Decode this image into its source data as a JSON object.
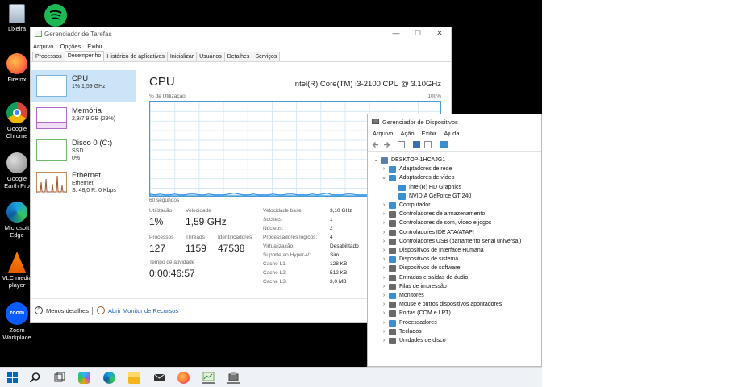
{
  "desktop": {
    "icons": [
      {
        "label": "Lixeira",
        "icon": "recycle-bin-icon"
      },
      {
        "label": "Firefox",
        "icon": "firefox-icon"
      },
      {
        "label": "Google Chrome",
        "icon": "chrome-icon"
      },
      {
        "label": "Google Earth Pro",
        "icon": "google-earth-icon"
      },
      {
        "label": "Microsoft Edge",
        "icon": "edge-icon"
      },
      {
        "label": "VLC media player",
        "icon": "vlc-icon"
      },
      {
        "label": "Zoom Workplace",
        "icon": "zoom-icon"
      }
    ],
    "zoom_logo_text": "zoom"
  },
  "taskmgr": {
    "title": "Gerenciador de Tarefas",
    "menu": [
      "Arquivo",
      "Opções",
      "Exibir"
    ],
    "tabs": [
      "Processos",
      "Desempenho",
      "Histórico de aplicativos",
      "Inicializar",
      "Usuários",
      "Detalhes",
      "Serviços"
    ],
    "active_tab": "Desempenho",
    "sidebar": [
      {
        "name": "CPU",
        "line1": "1% 1,59 GHz",
        "line2": "",
        "color": "#1e88e5"
      },
      {
        "name": "Memória",
        "line1": "2,3/7,9 GB (29%)",
        "line2": "",
        "color": "#9c27b0"
      },
      {
        "name": "Disco 0 (C:)",
        "line1": "SSD",
        "line2": "0%",
        "color": "#4caf50"
      },
      {
        "name": "Ethernet",
        "line1": "Ethernet",
        "line2": "S: 48,0 R: 0 Kbps",
        "color": "#a0522d"
      }
    ],
    "cpu": {
      "title": "CPU",
      "model": "Intel(R) Core(TM) i3-2100 CPU @ 3.10GHz",
      "graph_label": "% de Utilização",
      "graph_max": "100%",
      "graph_time": "60 segundos",
      "utilization_series": [
        2,
        1,
        2,
        1,
        1,
        2,
        1,
        1,
        2,
        2,
        1,
        1,
        2,
        1,
        1,
        1,
        2,
        3,
        2,
        1,
        1,
        2,
        1,
        1,
        1,
        2,
        1,
        1,
        2,
        2,
        1,
        1,
        1,
        2,
        1,
        2,
        3,
        1,
        1,
        1,
        2,
        2,
        1,
        1,
        1,
        2,
        1,
        1,
        2,
        1,
        1,
        2,
        2,
        4,
        3,
        2,
        1,
        2,
        1,
        1
      ],
      "stats": {
        "utilizacao_label": "Utilização",
        "utilizacao": "1%",
        "velocidade_label": "Velocidade",
        "velocidade": "1,59 GHz",
        "processos_label": "Processos",
        "processos": "127",
        "threads_label": "Threads",
        "threads": "1159",
        "identificadores_label": "Identificadores",
        "identificadores": "47538",
        "tempo_label": "Tempo de atividade",
        "tempo": "0:00:46:57"
      },
      "details": [
        {
          "k": "Velocidade base:",
          "v": "3,10 GHz"
        },
        {
          "k": "Sockets:",
          "v": "1"
        },
        {
          "k": "Núcleos:",
          "v": "2"
        },
        {
          "k": "Processadores lógicos:",
          "v": "4"
        },
        {
          "k": "Virtualização:",
          "v": "Desabilitado"
        },
        {
          "k": "Suporte ao Hyper-V:",
          "v": "Sim"
        },
        {
          "k": "Cache L1:",
          "v": "128 KB"
        },
        {
          "k": "Cache L2:",
          "v": "512 KB"
        },
        {
          "k": "Cache L3:",
          "v": "3,0 MB"
        }
      ]
    },
    "footer": {
      "fewer_details": "Menos detalhes",
      "resource_monitor": "Abrir Monitor de Recursos"
    }
  },
  "devmgr": {
    "title": "Gerenciador de Dispositivos",
    "menu": [
      "Arquivo",
      "Ação",
      "Exibir",
      "Ajuda"
    ],
    "tree": [
      {
        "label": "DESKTOP-1HCAJG1",
        "level": 0,
        "expanded": true,
        "color": "#5b7fa6"
      },
      {
        "label": "Adaptadores de rede",
        "level": 1,
        "expanded": false,
        "color": "#3a8fd1"
      },
      {
        "label": "Adaptadores de vídeo",
        "level": 1,
        "expanded": true,
        "color": "#3a8fd1"
      },
      {
        "label": "Intel(R) HD Graphics",
        "level": 2,
        "color": "#3a8fd1"
      },
      {
        "label": "NVIDIA GeForce GT 240",
        "level": 2,
        "color": "#3a8fd1"
      },
      {
        "label": "Computador",
        "level": 1,
        "expanded": false,
        "color": "#3a8fd1"
      },
      {
        "label": "Controladores de armazenamento",
        "level": 1,
        "expanded": false,
        "color": "#6a6a6a"
      },
      {
        "label": "Controladores de som, vídeo e jogos",
        "level": 1,
        "expanded": false,
        "color": "#6a6a6a"
      },
      {
        "label": "Controladores IDE ATA/ATAPI",
        "level": 1,
        "expanded": false,
        "color": "#6a6a6a"
      },
      {
        "label": "Controladores USB (barramento serial universal)",
        "level": 1,
        "expanded": false,
        "color": "#6a6a6a"
      },
      {
        "label": "Dispositivos de Interface Humana",
        "level": 1,
        "expanded": false,
        "color": "#6a6a6a"
      },
      {
        "label": "Dispositivos de sistema",
        "level": 1,
        "expanded": false,
        "color": "#3a8fd1"
      },
      {
        "label": "Dispositivos de software",
        "level": 1,
        "expanded": false,
        "color": "#6a6a6a"
      },
      {
        "label": "Entradas e saídas de áudio",
        "level": 1,
        "expanded": false,
        "color": "#6a6a6a"
      },
      {
        "label": "Filas de impressão",
        "level": 1,
        "expanded": false,
        "color": "#6a6a6a"
      },
      {
        "label": "Monitores",
        "level": 1,
        "expanded": false,
        "color": "#3a8fd1"
      },
      {
        "label": "Mouse e outros dispositivos apontadores",
        "level": 1,
        "expanded": false,
        "color": "#6a6a6a"
      },
      {
        "label": "Portas (COM e LPT)",
        "level": 1,
        "expanded": false,
        "color": "#6a6a6a"
      },
      {
        "label": "Processadores",
        "level": 1,
        "expanded": false,
        "color": "#3a8fd1"
      },
      {
        "label": "Teclados",
        "level": 1,
        "expanded": false,
        "color": "#6a6a6a"
      },
      {
        "label": "Unidades de disco",
        "level": 1,
        "expanded": false,
        "color": "#6a6a6a"
      }
    ]
  },
  "taskbar": {
    "icons": [
      "windows-start-icon",
      "search-icon",
      "task-view-icon",
      "copilot-icon",
      "edge-icon",
      "file-explorer-icon",
      "mail-icon",
      "firefox-icon",
      "task-manager-icon",
      "device-manager-icon"
    ],
    "active": [
      "task-manager-icon",
      "device-manager-icon"
    ]
  }
}
